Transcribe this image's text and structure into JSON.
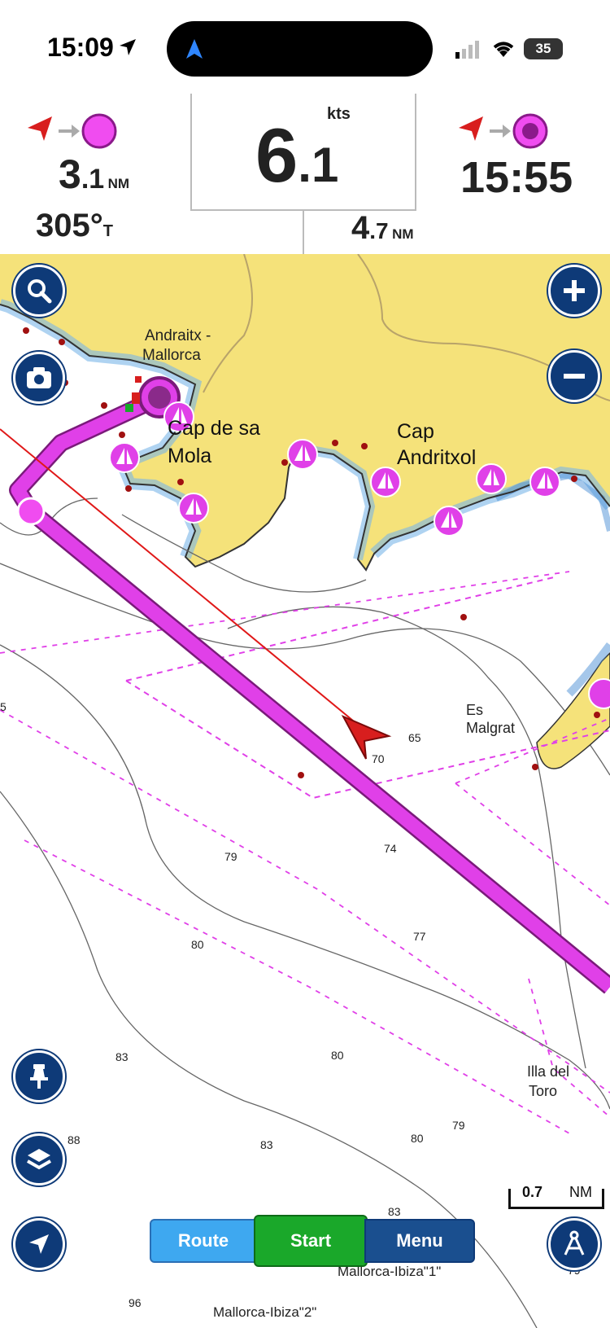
{
  "status": {
    "time": "15:09",
    "battery": "35"
  },
  "panel": {
    "left_top": {
      "value_int": "3",
      "value_dec": ".1",
      "unit": "NM"
    },
    "left_bottom": {
      "value": "305°",
      "unit": "T"
    },
    "speed": {
      "unit": "kts",
      "value_int": "6",
      "value_dec": ".1"
    },
    "right_top": {
      "value": "15:55"
    },
    "right_bottom": {
      "value_int": "4",
      "value_dec": ".7",
      "unit": "NM"
    }
  },
  "map": {
    "labels": {
      "andraitx": "Andraitx -",
      "mallorca": "Mallorca",
      "cap_sa_mola_1": "Cap de sa",
      "cap_sa_mola_2": "Mola",
      "cap_andritxol_1": "Cap",
      "cap_andritxol_2": "Andritxol",
      "es_malgrat_1": "Es",
      "es_malgrat_2": "Malgrat",
      "illa_del_toro_1": "Illa del",
      "illa_del_toro_2": "Toro",
      "ferry1": "Mallorca-Ibiza\"1\"",
      "ferry2": "Mallorca-Ibiza\"2\""
    },
    "depths": [
      "65",
      "70",
      "74",
      "79",
      "77",
      "80",
      "80",
      "83",
      "79",
      "80",
      "83",
      "88",
      "83",
      "96",
      "79",
      "5"
    ],
    "scale": {
      "value": "0.7",
      "unit": "NM"
    }
  },
  "buttons": {
    "route": "Route",
    "start": "Start",
    "menu": "Menu"
  },
  "colors": {
    "route": "#e040e8",
    "land": "#f5e27a",
    "button": "#0e3a78",
    "start": "#1aa82a",
    "route_btn": "#3ea8f0",
    "menu_btn": "#1a4f8f"
  }
}
